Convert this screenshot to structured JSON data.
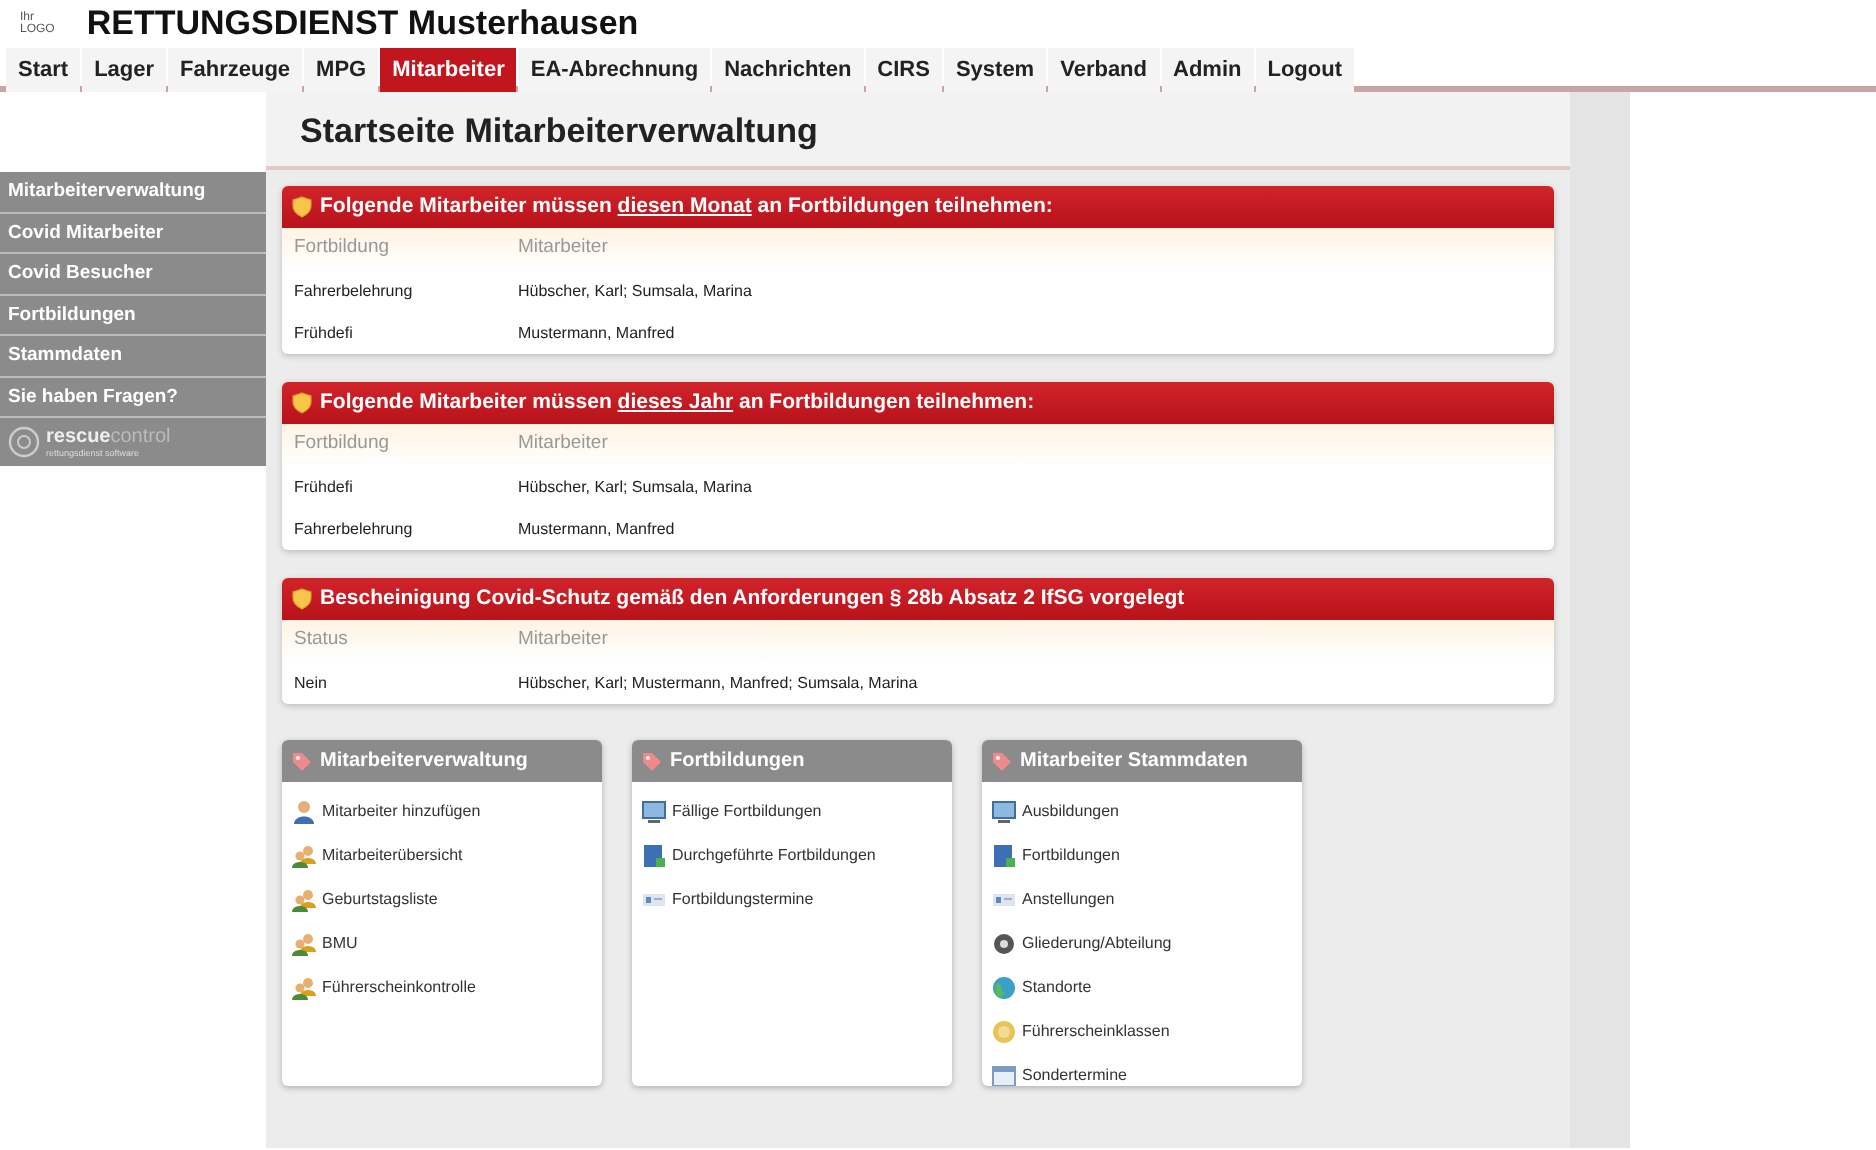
{
  "header": {
    "logo_small": "Ihr",
    "logo_text": "LOGO",
    "title": "RETTUNGSDIENST Musterhausen"
  },
  "nav": [
    {
      "label": "Start",
      "selected": false
    },
    {
      "label": "Lager",
      "selected": false
    },
    {
      "label": "Fahrzeuge",
      "selected": false
    },
    {
      "label": "MPG",
      "selected": false
    },
    {
      "label": "Mitarbeiter",
      "selected": true
    },
    {
      "label": "EA-Abrechnung",
      "selected": false
    },
    {
      "label": "Nachrichten",
      "selected": false
    },
    {
      "label": "CIRS",
      "selected": false
    },
    {
      "label": "System",
      "selected": false
    },
    {
      "label": "Verband",
      "selected": false
    },
    {
      "label": "Admin",
      "selected": false
    },
    {
      "label": "Logout",
      "selected": false
    }
  ],
  "page_title": "Startseite Mitarbeiterverwaltung",
  "sidebar": {
    "items": [
      "Mitarbeiterverwaltung",
      "Covid Mitarbeiter",
      "Covid Besucher",
      "Fortbildungen",
      "Stammdaten",
      "Sie haben Fragen?"
    ],
    "brand": {
      "part1": "rescue",
      "part2": "control",
      "tagline": "rettungsdienst software"
    }
  },
  "alerts": [
    {
      "title": [
        {
          "text": "Folgende Mitarbeiter müssen ",
          "underlined": false
        },
        {
          "text": "diesen Monat",
          "underlined": true
        },
        {
          "text": " an Fortbildungen teilnehmen:",
          "underlined": false
        }
      ],
      "columns": [
        "Fortbildung",
        "Mitarbeiter"
      ],
      "rows": [
        [
          "Fahrerbelehrung",
          "Hübscher, Karl; Sumsala, Marina"
        ],
        [
          "Frühdefi",
          "Mustermann, Manfred"
        ]
      ]
    },
    {
      "title": [
        {
          "text": "Folgende Mitarbeiter müssen ",
          "underlined": false
        },
        {
          "text": "dieses Jahr",
          "underlined": true
        },
        {
          "text": " an Fortbildungen teilnehmen:",
          "underlined": false
        }
      ],
      "columns": [
        "Fortbildung",
        "Mitarbeiter"
      ],
      "rows": [
        [
          "Frühdefi",
          "Hübscher, Karl; Sumsala, Marina"
        ],
        [
          "Fahrerbelehrung",
          "Mustermann, Manfred"
        ]
      ]
    },
    {
      "title": [
        {
          "text": "Bescheinigung Covid-Schutz gemäß den Anforderungen § 28b Absatz 2 IfSG vorgelegt",
          "underlined": false
        }
      ],
      "columns": [
        "Status",
        "Mitarbeiter"
      ],
      "rows": [
        [
          "Nein",
          "Hübscher, Karl; Mustermann, Manfred; Sumsala, Marina"
        ]
      ]
    }
  ],
  "tiles": [
    {
      "title": "Mitarbeiterverwaltung",
      "items": [
        {
          "label": "Mitarbeiter hinzufügen",
          "kind": "person"
        },
        {
          "label": "Mitarbeiterübersicht",
          "kind": "people"
        },
        {
          "label": "Geburtstagsliste",
          "kind": "people"
        },
        {
          "label": "BMU",
          "kind": "people"
        },
        {
          "label": "Führerscheinkontrolle",
          "kind": "people"
        }
      ]
    },
    {
      "title": "Fortbildungen",
      "items": [
        {
          "label": "Fällige Fortbildungen",
          "kind": "monitor"
        },
        {
          "label": "Durchgeführte Fortbildungen",
          "kind": "book"
        },
        {
          "label": "Fortbildungstermine",
          "kind": "strip"
        }
      ]
    },
    {
      "title": "Mitarbeiter Stammdaten",
      "items": [
        {
          "label": "Ausbildungen",
          "kind": "monitor"
        },
        {
          "label": "Fortbildungen",
          "kind": "book"
        },
        {
          "label": "Anstellungen",
          "kind": "strip"
        },
        {
          "label": "Gliederung/Abteilung",
          "kind": "gear"
        },
        {
          "label": "Standorte",
          "kind": "globe"
        },
        {
          "label": "Führerscheinklassen",
          "kind": "badge"
        },
        {
          "label": "Sondertermine",
          "kind": "calendar"
        }
      ]
    }
  ]
}
